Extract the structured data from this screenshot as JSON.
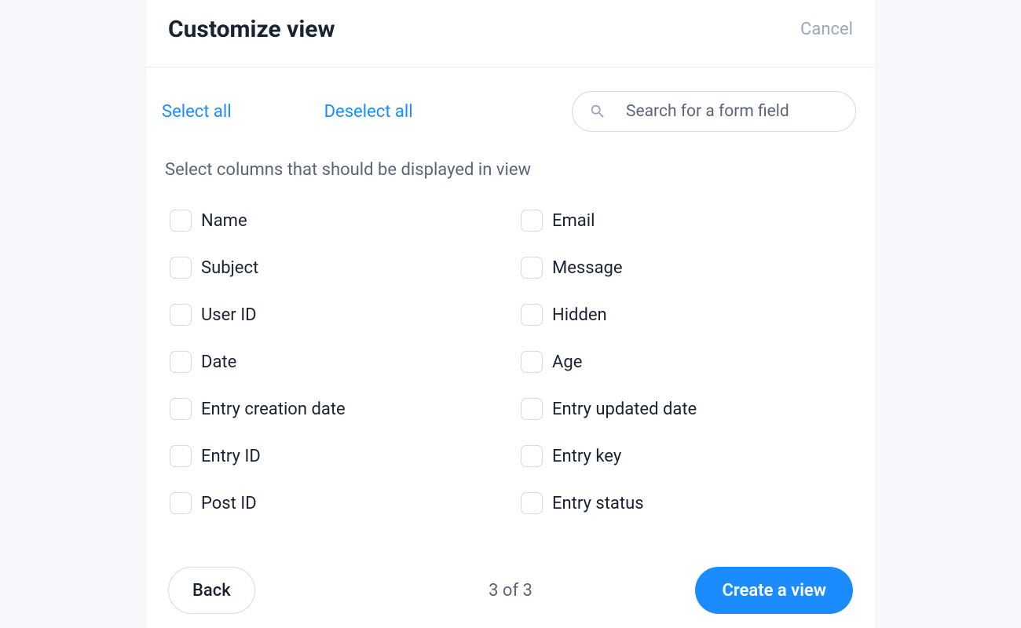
{
  "header": {
    "title": "Customize view",
    "cancel_label": "Cancel"
  },
  "toolbar": {
    "select_all_label": "Select all",
    "deselect_all_label": "Deselect all",
    "search": {
      "placeholder": "Search for a form field",
      "value": ""
    }
  },
  "description": "Select columns that should be displayed in view",
  "fields": {
    "left": [
      {
        "label": "Name"
      },
      {
        "label": "Subject"
      },
      {
        "label": "User ID"
      },
      {
        "label": "Date"
      },
      {
        "label": "Entry creation date"
      },
      {
        "label": "Entry ID"
      },
      {
        "label": "Post ID"
      }
    ],
    "right": [
      {
        "label": "Email"
      },
      {
        "label": "Message"
      },
      {
        "label": "Hidden"
      },
      {
        "label": "Age"
      },
      {
        "label": "Entry updated date"
      },
      {
        "label": "Entry key"
      },
      {
        "label": "Entry status"
      }
    ]
  },
  "footer": {
    "back_label": "Back",
    "step_indicator": "3 of 3",
    "create_label": "Create a view"
  }
}
